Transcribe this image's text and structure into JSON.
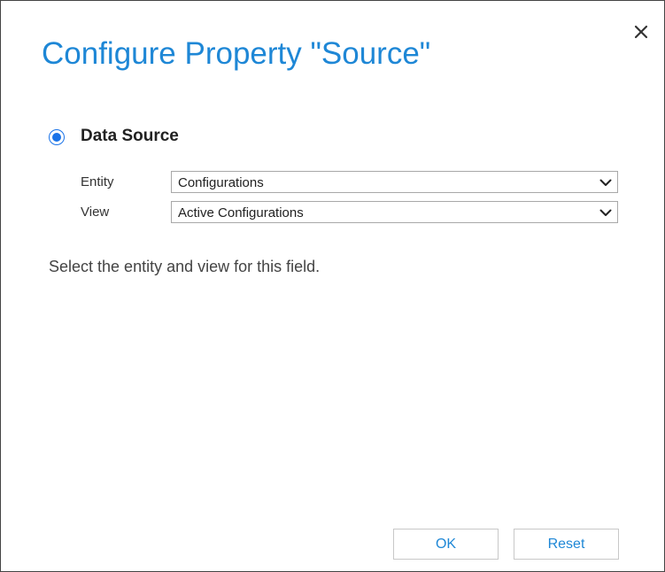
{
  "dialog": {
    "title": "Configure Property \"Source\"",
    "close_icon": "close-icon"
  },
  "data_source": {
    "label": "Data Source",
    "selected": true,
    "entity": {
      "label": "Entity",
      "value": "Configurations"
    },
    "view": {
      "label": "View",
      "value": "Active Configurations"
    }
  },
  "description": "Select the entity and view for this field.",
  "buttons": {
    "ok_label": "OK",
    "reset_label": "Reset"
  },
  "colors": {
    "accent": "#1e87d6",
    "radio": "#1a73e8",
    "border": "#a8a8a8"
  }
}
